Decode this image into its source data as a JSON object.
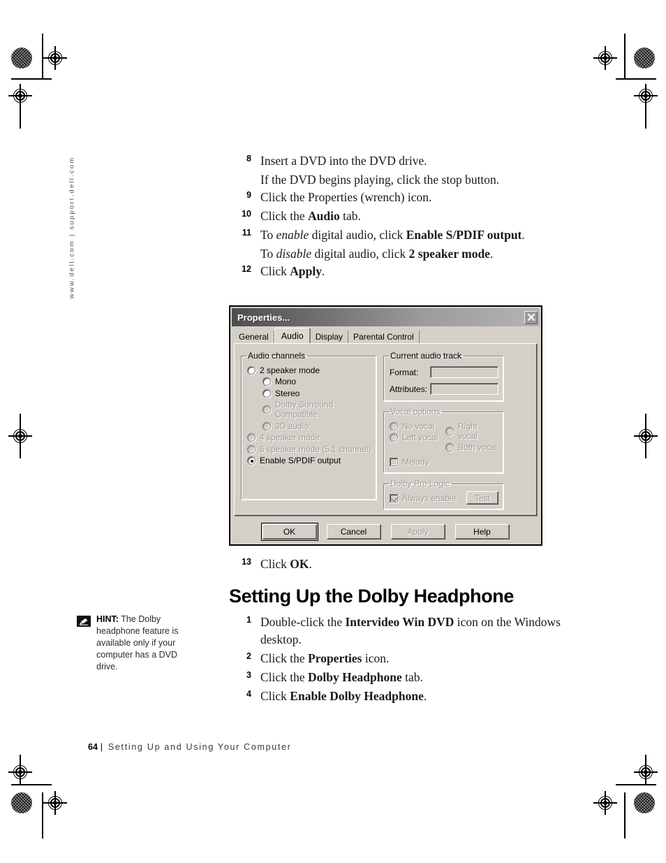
{
  "page": {
    "sidebar_url": "www.dell.com | support.dell.com",
    "footer_page_number": "64",
    "footer_separator": "|",
    "footer_title": "Setting Up and Using Your Computer"
  },
  "steps_top": [
    {
      "num": "8",
      "text_parts": [
        {
          "t": "Insert a DVD into the DVD drive.",
          "s": "n"
        }
      ]
    },
    {
      "num": "",
      "text_parts": [
        {
          "t": "If the DVD begins playing, click the stop button.",
          "s": "n"
        }
      ]
    },
    {
      "num": "9",
      "text_parts": [
        {
          "t": "Click the Properties (wrench) icon.",
          "s": "n"
        }
      ]
    },
    {
      "num": "10",
      "text_parts": [
        {
          "t": "Click the ",
          "s": "n"
        },
        {
          "t": "Audio",
          "s": "b"
        },
        {
          "t": " tab.",
          "s": "n"
        }
      ]
    },
    {
      "num": "11",
      "text_parts": [
        {
          "t": "To ",
          "s": "n"
        },
        {
          "t": "enable",
          "s": "i"
        },
        {
          "t": " digital audio, click ",
          "s": "n"
        },
        {
          "t": "Enable S/PDIF output",
          "s": "b"
        },
        {
          "t": ".",
          "s": "n"
        }
      ]
    },
    {
      "num": "",
      "text_parts": [
        {
          "t": "To ",
          "s": "n"
        },
        {
          "t": "disable",
          "s": "i"
        },
        {
          "t": " digital audio, click ",
          "s": "n"
        },
        {
          "t": "2 speaker mode",
          "s": "b"
        },
        {
          "t": ".",
          "s": "n"
        }
      ]
    },
    {
      "num": "12",
      "text_parts": [
        {
          "t": "Click ",
          "s": "n"
        },
        {
          "t": "Apply",
          "s": "b"
        },
        {
          "t": ".",
          "s": "n"
        }
      ]
    }
  ],
  "step_13": {
    "num": "13",
    "text_parts": [
      {
        "t": "Click ",
        "s": "n"
      },
      {
        "t": "OK",
        "s": "b"
      },
      {
        "t": ".",
        "s": "n"
      }
    ]
  },
  "section_heading": "Setting Up the Dolby Headphone",
  "steps_bottom": [
    {
      "num": "1",
      "text_parts": [
        {
          "t": "Double-click the ",
          "s": "n"
        },
        {
          "t": "Intervideo Win DVD",
          "s": "b"
        },
        {
          "t": " icon on the Windows desktop.",
          "s": "n"
        }
      ]
    },
    {
      "num": "2",
      "text_parts": [
        {
          "t": "Click the ",
          "s": "n"
        },
        {
          "t": "Properties",
          "s": "b"
        },
        {
          "t": " icon.",
          "s": "n"
        }
      ]
    },
    {
      "num": "3",
      "text_parts": [
        {
          "t": "Click the ",
          "s": "n"
        },
        {
          "t": "Dolby Headphone",
          "s": "b"
        },
        {
          "t": " tab.",
          "s": "n"
        }
      ]
    },
    {
      "num": "4",
      "text_parts": [
        {
          "t": "Click ",
          "s": "n"
        },
        {
          "t": "Enable Dolby Headphone",
          "s": "b"
        },
        {
          "t": ".",
          "s": "n"
        }
      ]
    }
  ],
  "hint": {
    "icon": "pencil-note-icon",
    "label": "HINT:",
    "body": " The Dolby headphone feature is available only if your computer has a DVD drive."
  },
  "dialog": {
    "title": "Properties...",
    "close_icon": "close-icon",
    "tabs": [
      {
        "label": "General",
        "active": false
      },
      {
        "label": "Audio",
        "active": true
      },
      {
        "label": "Display",
        "active": false
      },
      {
        "label": "Parental Control",
        "active": false
      }
    ],
    "audio_channels": {
      "legend": "Audio channels",
      "options": [
        {
          "label": "2 speaker mode",
          "selected": false,
          "disabled": false,
          "indent": false
        },
        {
          "label": "Mono",
          "selected": false,
          "disabled": false,
          "indent": true
        },
        {
          "label": "Stereo",
          "selected": false,
          "disabled": false,
          "indent": true
        },
        {
          "label": "Dolby Surround Compatible",
          "selected": false,
          "disabled": true,
          "indent": true
        },
        {
          "label": "3D audio",
          "selected": false,
          "disabled": true,
          "indent": true
        },
        {
          "label": "4 speaker mode",
          "selected": false,
          "disabled": true,
          "indent": false
        },
        {
          "label": "6 speaker mode (5.1 channel)",
          "selected": false,
          "disabled": true,
          "indent": false
        },
        {
          "label": "Enable S/PDIF output",
          "selected": true,
          "disabled": false,
          "indent": false
        }
      ]
    },
    "current_audio_track": {
      "legend": "Current audio track",
      "fields": [
        {
          "label": "Format:",
          "value": ""
        },
        {
          "label": "Attributes:",
          "value": ""
        }
      ]
    },
    "vocal_options": {
      "legend": "Vocal options",
      "radios": [
        {
          "label": "No vocal",
          "selected": false,
          "disabled": true
        },
        {
          "label": "Right vocal",
          "selected": false,
          "disabled": true
        },
        {
          "label": "Left vocal",
          "selected": false,
          "disabled": true
        },
        {
          "label": "Both vocal",
          "selected": false,
          "disabled": true
        }
      ],
      "checkbox": {
        "label": "Melody",
        "checked": false,
        "disabled": true
      }
    },
    "dolby_pro_logic": {
      "legend": "Dolby Pro Logic",
      "checkbox": {
        "label": "Always enable",
        "checked": true,
        "disabled": true
      },
      "test_button": "Test"
    },
    "buttons": [
      {
        "label": "OK",
        "default": true,
        "disabled": false
      },
      {
        "label": "Cancel",
        "default": false,
        "disabled": false
      },
      {
        "label": "Apply",
        "default": false,
        "disabled": true
      },
      {
        "label": "Help",
        "default": false,
        "disabled": false
      }
    ]
  },
  "colors": {
    "dialog_face": "#d4d0c8",
    "title_gradient_start": "#4e4e4e",
    "title_gradient_end": "#b4b4b4",
    "disabled_text": "#9a9a9a",
    "page_bg": "#ffffff"
  }
}
